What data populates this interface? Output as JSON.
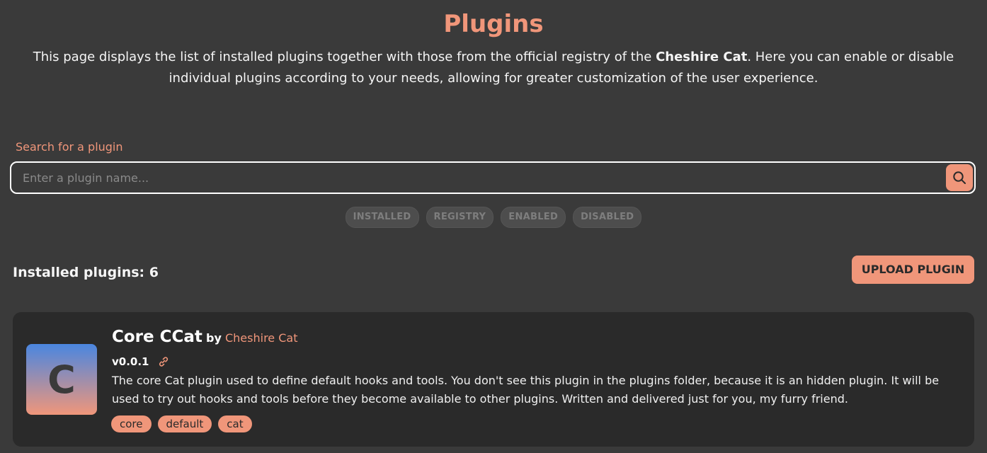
{
  "header": {
    "title": "Plugins",
    "intro_before": "This page displays the list of installed plugins together with those from the official registry of the ",
    "intro_brand": "Cheshire Cat",
    "intro_after": ". Here you can enable or disable individual plugins according to your needs, allowing for greater customization of the user experience."
  },
  "search": {
    "label": "Search for a plugin",
    "placeholder": "Enter a plugin name...",
    "value": "",
    "button_icon": "search-icon"
  },
  "filters": [
    {
      "label": "INSTALLED"
    },
    {
      "label": "REGISTRY"
    },
    {
      "label": "ENABLED"
    },
    {
      "label": "DISABLED"
    }
  ],
  "installed": {
    "label": "Installed plugins: 6"
  },
  "upload_button": {
    "label": "UPLOAD PLUGIN"
  },
  "plugins": [
    {
      "icon_letter": "C",
      "name": "Core CCat",
      "by": "by",
      "author": "Cheshire Cat",
      "version": "v0.0.1",
      "link_icon": "link-icon",
      "description": "The core Cat plugin used to define default hooks and tools. You don't see this plugin in the plugins folder, because it is an hidden plugin. It will be used to try out hooks and tools before they become available to other plugins. Written and delivered just for you, my furry friend.",
      "tags": [
        "core",
        "default",
        "cat"
      ]
    }
  ],
  "colors": {
    "accent": "#f0967a",
    "background": "#3a3a3a",
    "card": "#2a2a2a",
    "icon_gradient_top": "#4a86e0"
  }
}
